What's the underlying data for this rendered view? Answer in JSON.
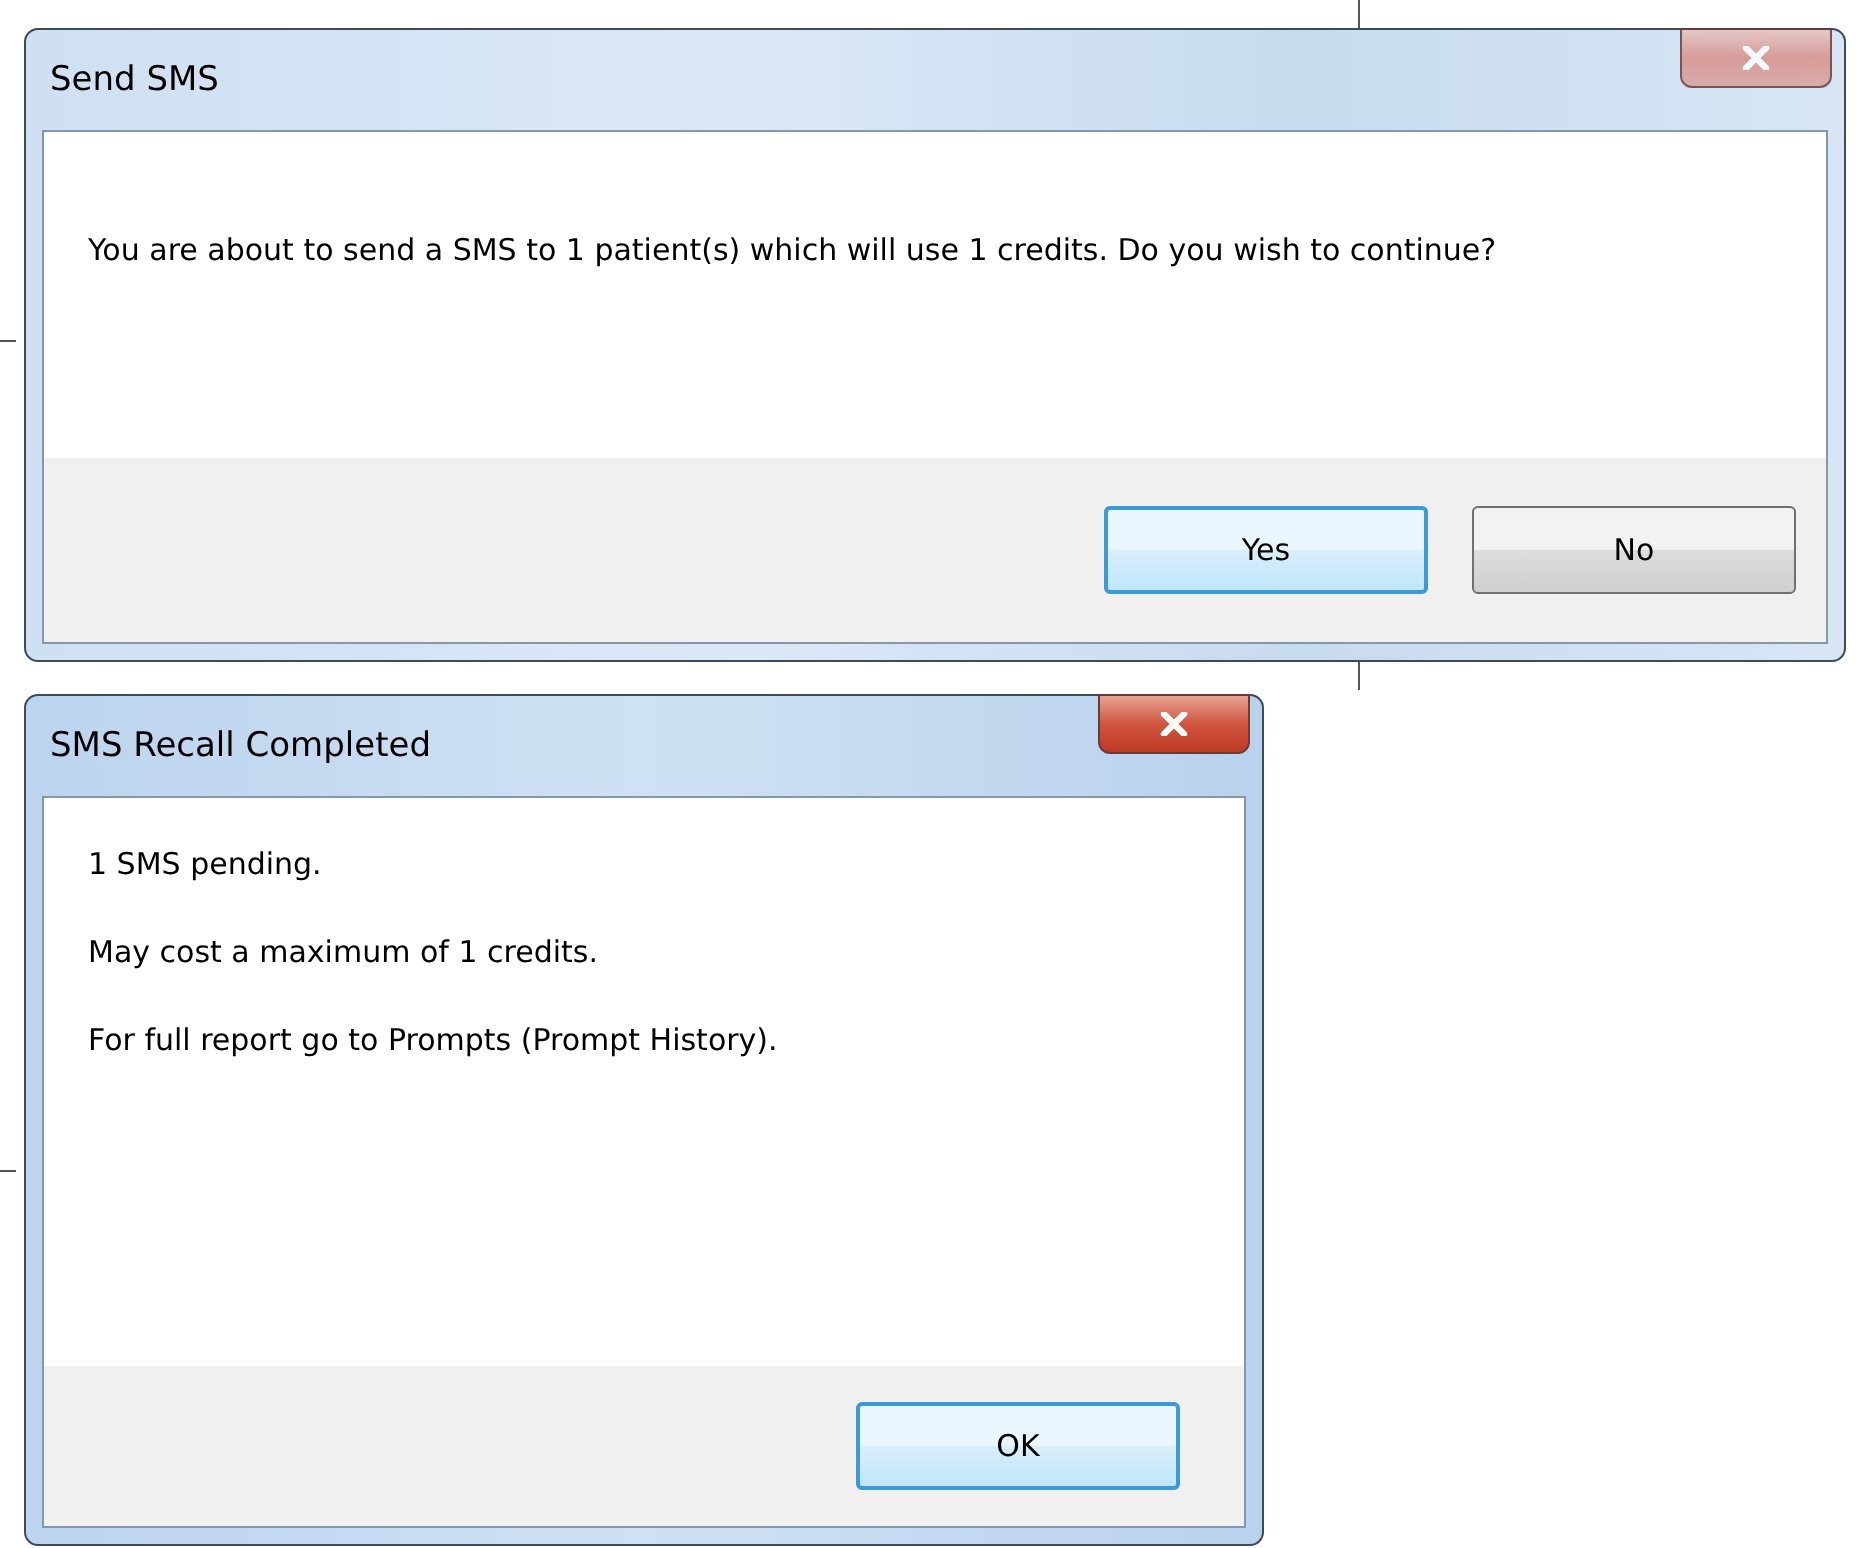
{
  "dialogs": [
    {
      "title": "Send SMS",
      "active": false,
      "paragraphs": [
        "You are about to send a SMS to 1 patient(s) which will use 1 credits. Do you wish to continue?"
      ],
      "buttons": [
        {
          "label": "Yes",
          "default": true
        },
        {
          "label": "No",
          "default": false
        }
      ]
    },
    {
      "title": "SMS Recall Completed",
      "active": true,
      "paragraphs": [
        "1 SMS pending.",
        "May cost a maximum of 1 credits.",
        "For full report go to Prompts (Prompt History)."
      ],
      "buttons": [
        {
          "label": "OK",
          "default": true
        }
      ]
    }
  ]
}
